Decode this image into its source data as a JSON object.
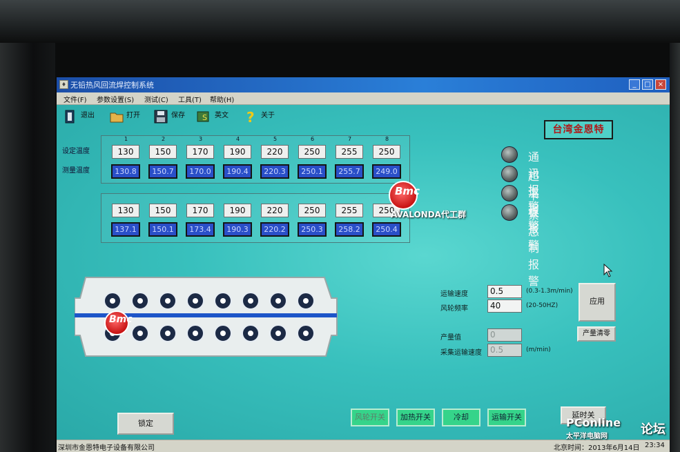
{
  "window": {
    "title": "无铅热风回流焊控制系统"
  },
  "menu": [
    {
      "label": "文件(F)"
    },
    {
      "label": "参数设置(S)"
    },
    {
      "label": "测试(C)"
    },
    {
      "label": "工具(T)"
    },
    {
      "label": "帮助(H)"
    }
  ],
  "toolbar": {
    "exit": "退出",
    "open": "打开",
    "save": "保存",
    "english": "英文",
    "about": "关于"
  },
  "brand": "台湾金恩特",
  "upper_zone": {
    "zone_numbers": [
      "1",
      "2",
      "3",
      "4",
      "5",
      "6",
      "7",
      "8"
    ],
    "set_label": "设定温度",
    "measured_label": "测量温度",
    "set_temps": [
      "130",
      "150",
      "170",
      "190",
      "220",
      "250",
      "255",
      "250"
    ],
    "measured_temps": [
      "130.8",
      "150.7",
      "170.0",
      "190.4",
      "220.3",
      "250.1",
      "255.7",
      "249.0"
    ]
  },
  "lower_zone": {
    "set_temps": [
      "130",
      "150",
      "170",
      "190",
      "220",
      "250",
      "255",
      "250"
    ],
    "measured_temps": [
      "137.1",
      "150.1",
      "173.4",
      "190.3",
      "220.2",
      "250.3",
      "258.2",
      "250.4"
    ]
  },
  "alarms": [
    {
      "label": "通讯报警"
    },
    {
      "label": "超温报警"
    },
    {
      "label": "卡板报警"
    },
    {
      "label": "紧急制报警"
    }
  ],
  "conveyor": {
    "speed_label": "运输速度",
    "speed_value": "0.5",
    "speed_unit": "(0.3-1.3m/min)",
    "fan_label": "风轮频率",
    "fan_value": "40",
    "fan_unit": "(20-50HZ)",
    "apply_label": "应用",
    "output_label": "产量值",
    "output_value": "0",
    "clear_label": "产量清零",
    "sample_speed_label": "采集运输速度",
    "sample_speed_value": "0.5",
    "sample_speed_unit": "(m/min)"
  },
  "bottom_buttons": {
    "lock": "锁定",
    "fan_switch": "风轮开关",
    "heat_switch": "加热开关",
    "cooling": "冷却",
    "transport_switch": "运输开关",
    "delay": "延时关"
  },
  "statusbar": {
    "company": "深圳市金恩特电子设备有限公司",
    "datetime": "北京时间：2013年6月14日",
    "clock": "23:34"
  },
  "watermark": {
    "bmc": "Bmc",
    "avalonda": "AVALONDA代工群",
    "pconline": "PConline",
    "pconline_cn": "太平洋电脑网",
    "forum": "论坛"
  },
  "colors": {
    "screen": "#38c0bd",
    "measured_box": "#2a4fc8",
    "action_button": "#35d48a",
    "titlebar": "#2a7fd8"
  }
}
